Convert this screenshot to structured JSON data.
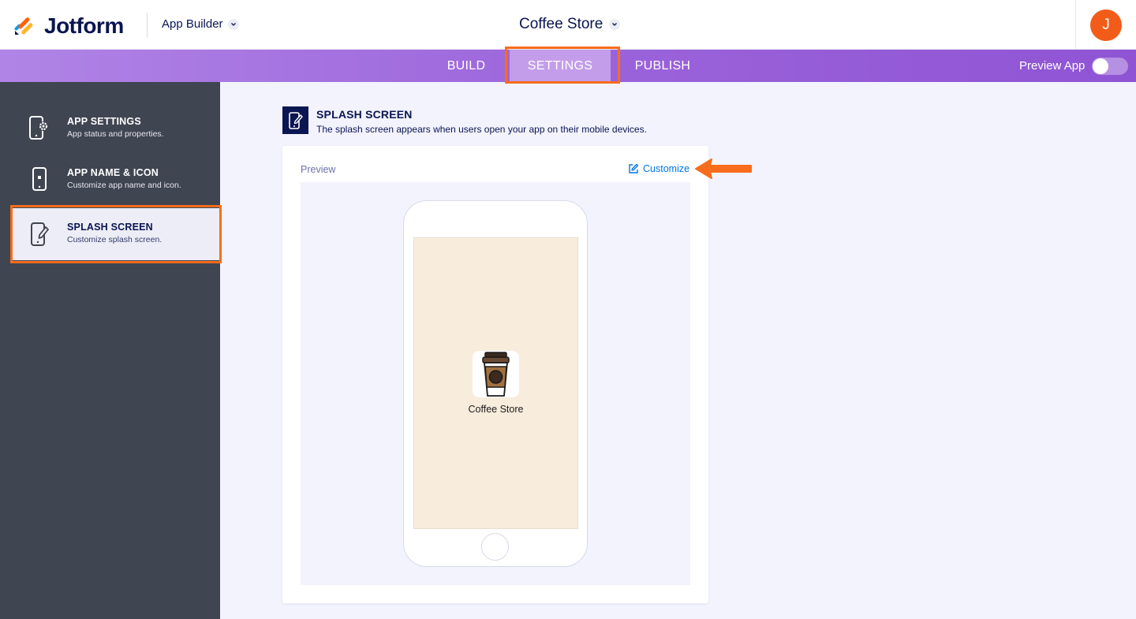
{
  "header": {
    "logo_text": "Jotform",
    "app_builder_label": "App Builder",
    "app_title": "Coffee Store",
    "avatar_initial": "J"
  },
  "nav": {
    "tabs": [
      {
        "label": "BUILD",
        "active": false
      },
      {
        "label": "SETTINGS",
        "active": true
      },
      {
        "label": "PUBLISH",
        "active": false
      }
    ],
    "preview_label": "Preview App",
    "preview_toggle_on": false
  },
  "sidebar": {
    "items": [
      {
        "title": "APP SETTINGS",
        "subtitle": "App status and properties.",
        "icon": "phone-gear-icon",
        "active": false
      },
      {
        "title": "APP NAME & ICON",
        "subtitle": "Customize app name and icon.",
        "icon": "phone-icon",
        "active": false
      },
      {
        "title": "SPLASH SCREEN",
        "subtitle": "Customize splash screen.",
        "icon": "phone-edit-icon",
        "active": true
      }
    ]
  },
  "main": {
    "section_title": "SPLASH SCREEN",
    "section_description": "The splash screen appears when users open your app on their mobile devices.",
    "preview_label": "Preview",
    "customize_label": "Customize",
    "splash": {
      "app_name": "Coffee Store",
      "app_icon": "coffee-cup-icon",
      "background_color": "#f8ecdc"
    }
  },
  "colors": {
    "accent_orange": "#f76d1c",
    "brand_navy": "#0a1551",
    "nav_purple": "#9a62da",
    "sidebar_bg": "#3f4551",
    "link_blue": "#0075e3",
    "avatar_bg": "#f25c19"
  }
}
